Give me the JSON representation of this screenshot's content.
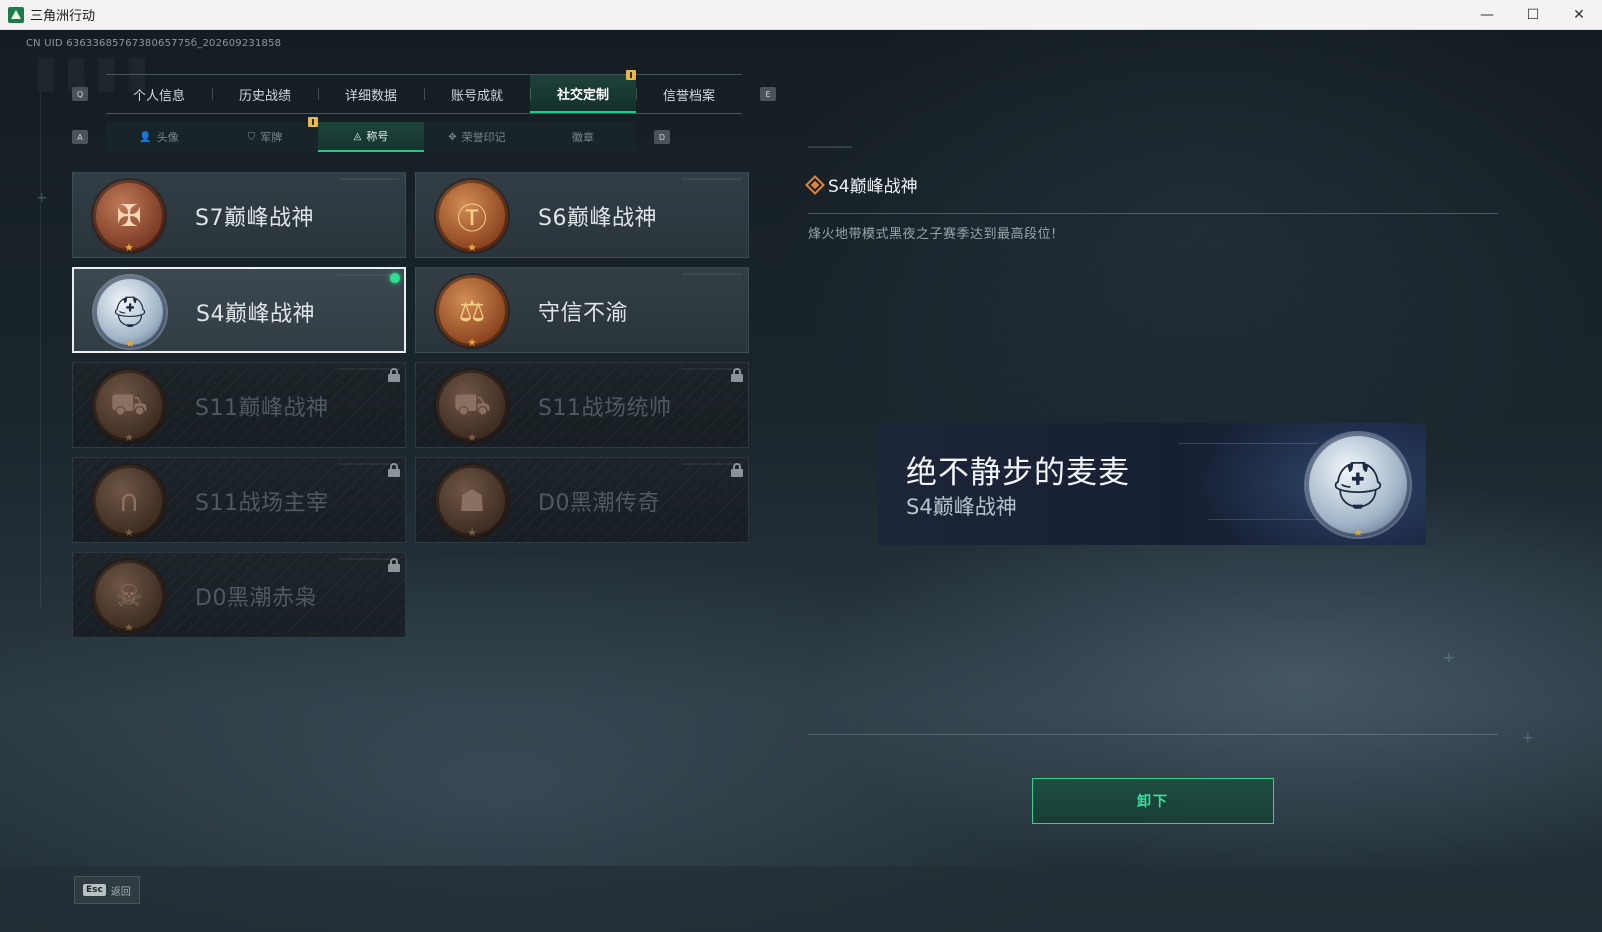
{
  "window": {
    "title": "三角洲行动",
    "controls": {
      "minimize": "—",
      "maximize": "☐",
      "close": "✕"
    }
  },
  "uid_text": "CN UID 6363368576738065775б_202609231858",
  "main_tabs": {
    "left_key": "Q",
    "right_key": "E",
    "items": [
      {
        "label": "个人信息",
        "active": false
      },
      {
        "label": "历史战绩",
        "active": false
      },
      {
        "label": "详细数据",
        "active": false
      },
      {
        "label": "账号成就",
        "active": false
      },
      {
        "label": "社交定制",
        "active": true,
        "notice": true
      },
      {
        "label": "信誉档案",
        "active": false
      }
    ]
  },
  "sub_tabs": {
    "left_key": "A",
    "right_key": "D",
    "items": [
      {
        "label": "头像",
        "icon": "person-icon",
        "active": false
      },
      {
        "label": "军牌",
        "icon": "dogtag-icon",
        "active": false,
        "notice": true
      },
      {
        "label": "称号",
        "icon": "title-icon",
        "active": true
      },
      {
        "label": "荣誉印记",
        "icon": "honor-mark-icon",
        "active": false
      },
      {
        "label": "徽章",
        "icon": "",
        "active": false
      }
    ]
  },
  "titles": [
    {
      "label": "S7巅峰战神",
      "medal": "crossbow-medal-icon",
      "glyph": "✠",
      "tone": "bronze",
      "locked": false,
      "selected": false,
      "equipped": false
    },
    {
      "label": "S6巅峰战神",
      "medal": "t-emblem-medal-icon",
      "glyph": "Ⓣ",
      "tone": "gold",
      "locked": false,
      "selected": false,
      "equipped": false
    },
    {
      "label": "S4巅峰战神",
      "medal": "night-vision-helmet-medal-icon",
      "glyph": "⛑",
      "tone": "silver",
      "locked": false,
      "selected": true,
      "equipped": true
    },
    {
      "label": "守信不渝",
      "medal": "scales-medal-icon",
      "glyph": "⚖",
      "tone": "gold",
      "locked": false,
      "selected": false,
      "equipped": false
    },
    {
      "label": "S11巅峰战神",
      "medal": "tank-medal-icon",
      "glyph": "⛟",
      "tone": "dim",
      "locked": true,
      "selected": false,
      "equipped": false
    },
    {
      "label": "S11战场统帅",
      "medal": "armored-vehicle-medal-icon",
      "glyph": "⛟",
      "tone": "dim",
      "locked": true,
      "selected": false,
      "equipped": false
    },
    {
      "label": "S11战场主宰",
      "medal": "arch-medal-icon",
      "glyph": "∩",
      "tone": "dim",
      "locked": true,
      "selected": false,
      "equipped": false
    },
    {
      "label": "D0黑潮传奇",
      "medal": "hooded-figure-medal-icon",
      "glyph": "☗",
      "tone": "dim",
      "locked": true,
      "selected": false,
      "equipped": false
    },
    {
      "label": "D0黑潮赤枭",
      "medal": "masked-face-medal-icon",
      "glyph": "☠",
      "tone": "dim",
      "locked": true,
      "selected": false,
      "equipped": false
    }
  ],
  "detail": {
    "title": "S4巅峰战神",
    "description": "烽火地带模式黑夜之子赛季达到最高段位!"
  },
  "preview": {
    "player_name": "绝不静步的麦麦",
    "title": "S4巅峰战神",
    "medal": "night-vision-helmet-medal-icon",
    "glyph": "⛑"
  },
  "actions": {
    "unequip_label": "卸下"
  },
  "footer": {
    "esc_key": "Esc",
    "back_label": "返回"
  },
  "colors": {
    "accent_green": "#2ee08f",
    "notice_yellow": "#e8b84a",
    "detail_orange": "#e2863c"
  }
}
